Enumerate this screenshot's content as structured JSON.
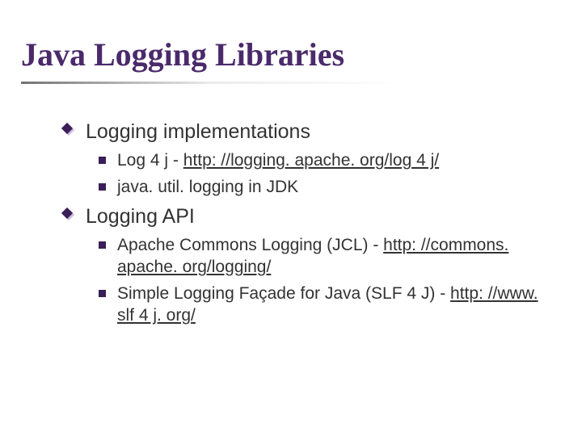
{
  "title": "Java Logging Libraries",
  "sections": [
    {
      "heading": "Logging implementations",
      "items": [
        {
          "prefix": "Log 4 j - ",
          "link": "http: //logging. apache. org/log 4 j/",
          "suffix": ""
        },
        {
          "prefix": "java. util. logging in JDK",
          "link": "",
          "suffix": ""
        }
      ]
    },
    {
      "heading": "Logging API",
      "items": [
        {
          "prefix": "Apache Commons Logging (JCL) - ",
          "link": "http: //commons. apache. org/logging/",
          "suffix": ""
        },
        {
          "prefix": "Simple Logging Façade for Java (SLF 4 J) - ",
          "link": "http: //www. slf 4 j. org/",
          "suffix": ""
        }
      ]
    }
  ]
}
